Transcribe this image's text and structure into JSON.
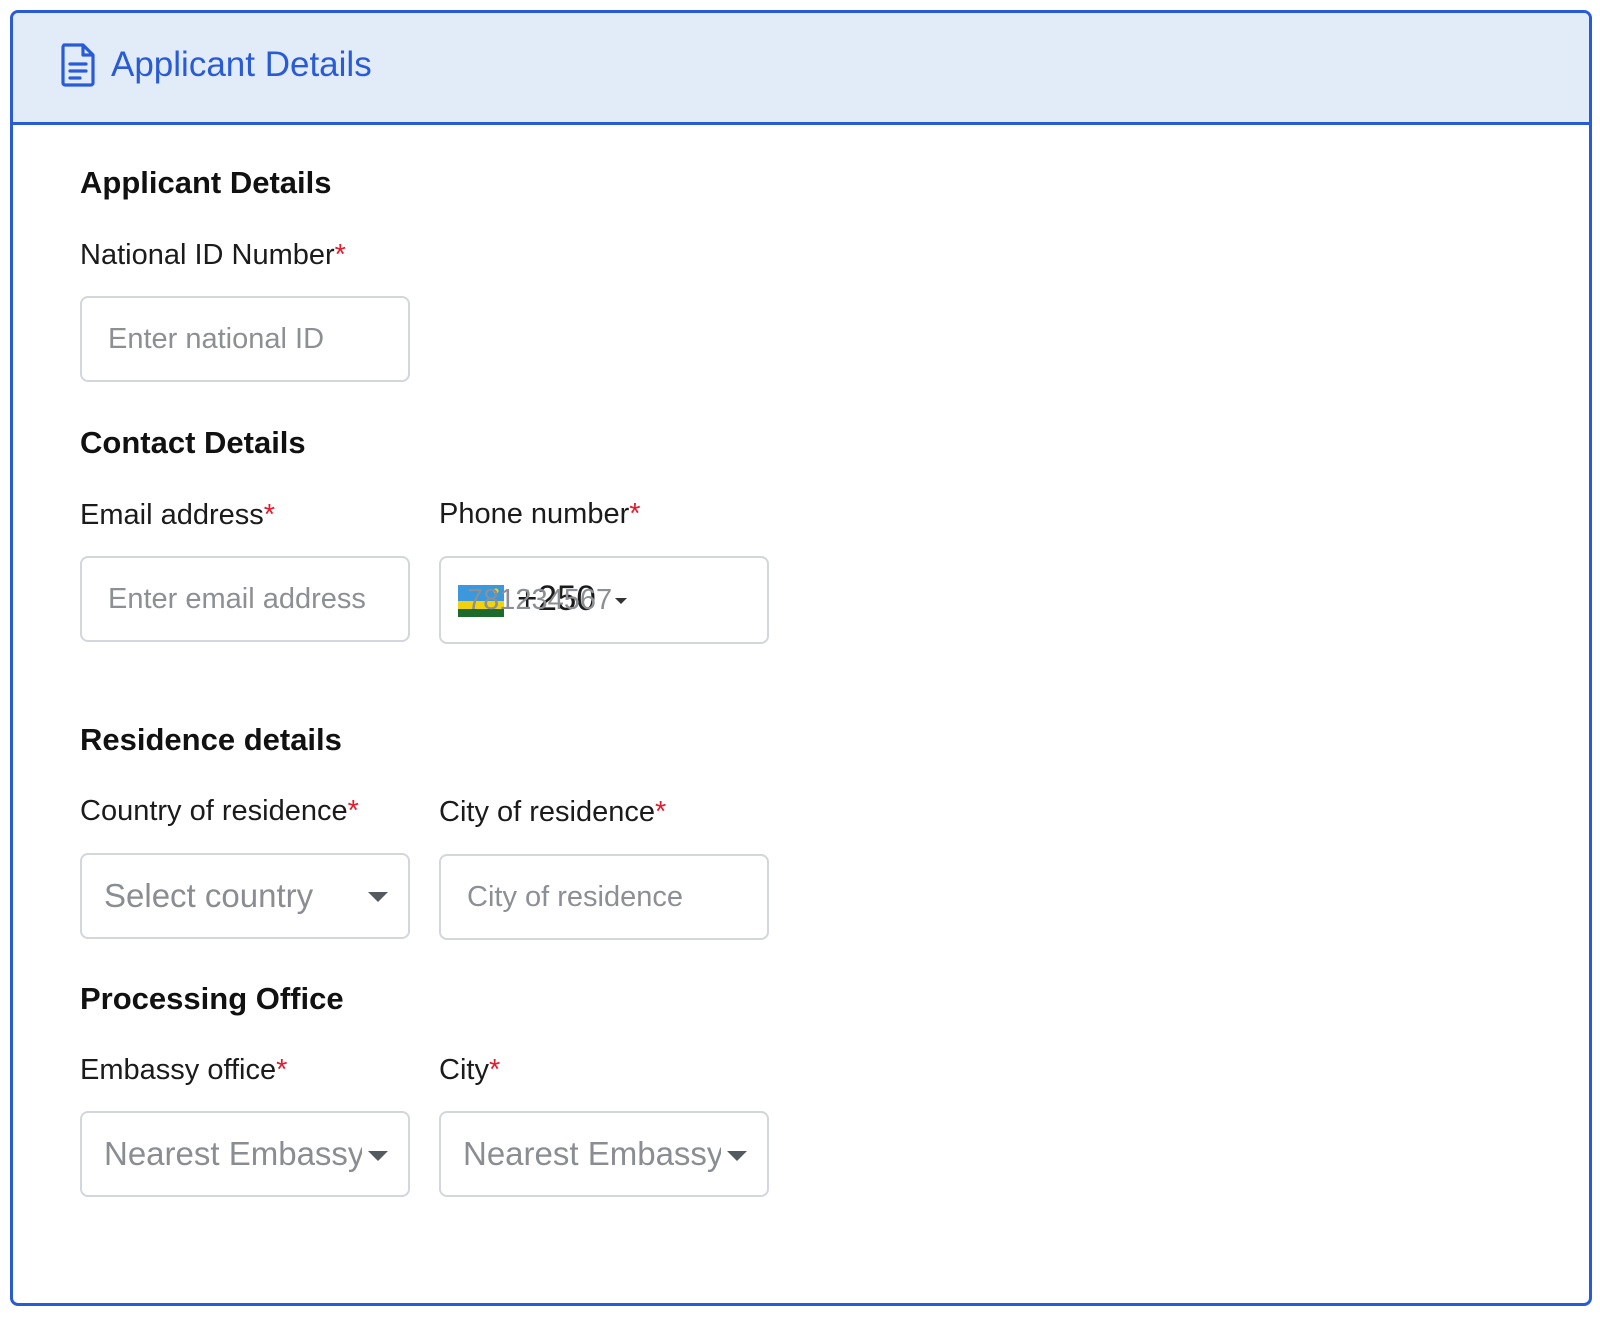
{
  "header": {
    "title": "Applicant Details",
    "icon": "document-icon",
    "accent_color": "#2a5bd7",
    "background": "#e1ecf8"
  },
  "applicant": {
    "title": "Applicant Details",
    "national_id": {
      "label": "National ID Number",
      "required_mark": "*",
      "placeholder": "Enter national ID"
    }
  },
  "contact": {
    "title": "Contact Details",
    "email": {
      "label": "Email address",
      "required_mark": "*",
      "placeholder": "Enter email address"
    },
    "phone": {
      "label": "Phone number",
      "required_mark": "*",
      "dial_code": "+250",
      "flag": "rwanda-flag-icon",
      "placeholder": "781234567"
    }
  },
  "residence": {
    "title": "Residence details",
    "country": {
      "label": "Country of residence",
      "required_mark": "*",
      "placeholder": "Select country"
    },
    "city": {
      "label": "City of residence",
      "required_mark": "*",
      "placeholder": "City of residence"
    }
  },
  "processing": {
    "title": "Processing Office",
    "embassy": {
      "label": "Embassy office",
      "required_mark": "*",
      "placeholder": "Nearest Embassy"
    },
    "city": {
      "label": "City",
      "required_mark": "*",
      "placeholder": "Nearest Embassy"
    }
  }
}
